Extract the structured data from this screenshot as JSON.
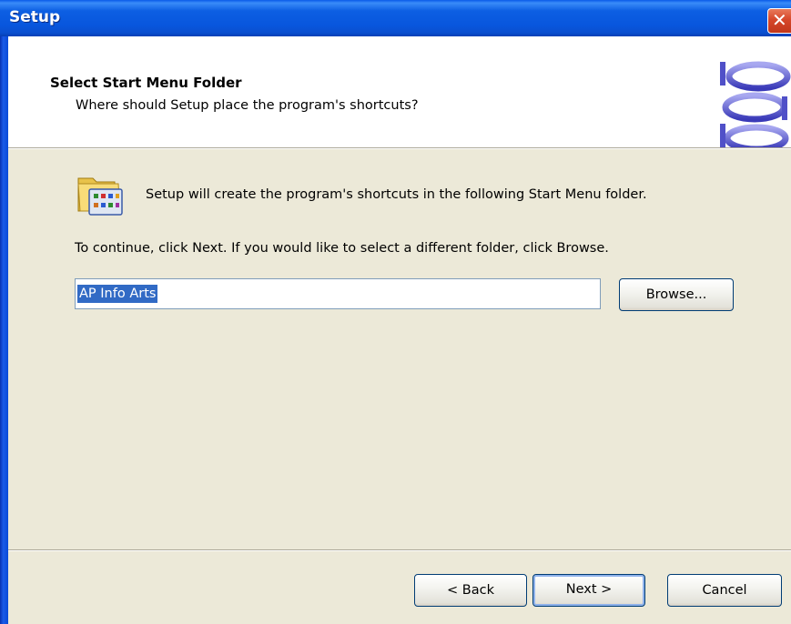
{
  "window": {
    "title": "Setup",
    "close_icon": "close-icon"
  },
  "header": {
    "title": "Select Start Menu Folder",
    "subtitle": "Where should Setup place the program's shortcuts?",
    "logo_icon": "installer-logo-icon"
  },
  "body": {
    "folder_icon": "start-menu-folder-icon",
    "description": "Setup will create the program's shortcuts in the following Start Menu folder.",
    "instruction": "To continue, click Next. If you would like to select a different folder, click Browse.",
    "folder_input_value": "AP Info Arts",
    "browse_label": "Browse..."
  },
  "footer": {
    "back_label": "< Back",
    "next_label": "Next >",
    "cancel_label": "Cancel"
  },
  "colors": {
    "titlebar": "#0a5ae8",
    "dialog_bg": "#ece9d8",
    "header_bg": "#ffffff",
    "selection": "#316ac5",
    "close_button": "#d6472a"
  }
}
